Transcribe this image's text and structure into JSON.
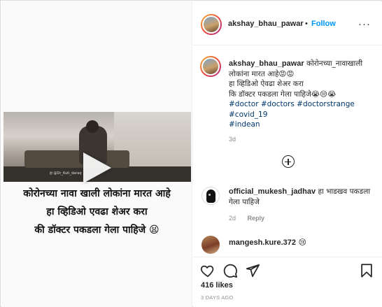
{
  "media": {
    "watermark": "ड्रा @Dr_Kuti_daraq",
    "caption_lines": [
      "कोरोनच्या नावा खाली लोकांना मारत आहे",
      "हा व्हिडिओ एवढा शेअर करा",
      "की डॉक्टर पकडला गेला पाहिजे 😫"
    ]
  },
  "header": {
    "username": "akshay_bhau_pawar",
    "separator": "•",
    "follow_label": "Follow",
    "more_label": "···"
  },
  "caption": {
    "username": "akshay_bhau_pawar",
    "text_lines": [
      "कोरोनच्या_नावाखाली लोकांना मारत आहे😡😡",
      "हा व्हिडिओ ऐवढा शेअर करा",
      "कि डॉक्टर पकडला गेला पाहिजे😭😒😭"
    ],
    "hashtags": [
      "#doctor #doctors #doctorstrange",
      "#covid_19",
      "#indean"
    ],
    "age": "3d"
  },
  "comments": [
    {
      "username": "official_mukesh_jadhav",
      "text": "हा भाडखव पकडला गेला पाहिजे",
      "age": "2d",
      "reply_label": "Reply"
    },
    {
      "username": "mangesh.kure.372",
      "text": "😢"
    }
  ],
  "footer": {
    "likes": "416 likes",
    "date": "3 DAYS AGO"
  },
  "icons": [
    "heart-icon",
    "comment-icon",
    "share-icon",
    "bookmark-icon",
    "add-comment-icon",
    "play-icon"
  ],
  "colors": {
    "accent": "#0095f6",
    "hashtag": "#00376b",
    "muted": "#8e8e8e"
  }
}
